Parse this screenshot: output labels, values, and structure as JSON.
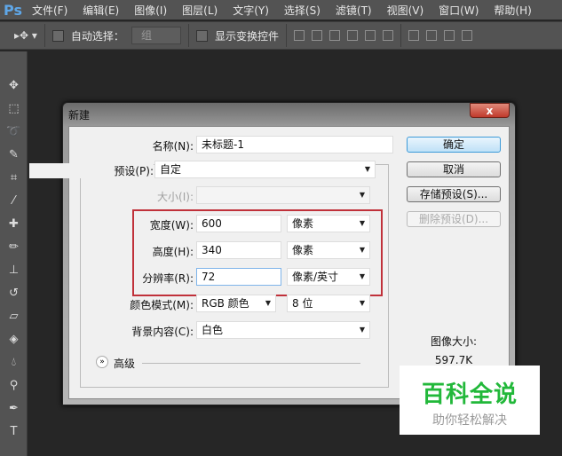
{
  "app": {
    "logo": "Ps"
  },
  "menu": [
    "文件(F)",
    "编辑(E)",
    "图像(I)",
    "图层(L)",
    "文字(Y)",
    "选择(S)",
    "滤镜(T)",
    "视图(V)",
    "窗口(W)",
    "帮助(H)"
  ],
  "options": {
    "auto_select": "自动选择：",
    "auto_select_value": "组",
    "show_transform": "显示变换控件"
  },
  "dialog": {
    "title": "新建",
    "name_label": "名称(N):",
    "name_value": "未标题-1",
    "preset_label": "预设(P):",
    "preset_value": "自定",
    "size_label": "大小(I):",
    "width_label": "宽度(W):",
    "width_value": "600",
    "width_unit": "像素",
    "height_label": "高度(H):",
    "height_value": "340",
    "height_unit": "像素",
    "res_label": "分辨率(R):",
    "res_value": "72",
    "res_unit": "像素/英寸",
    "mode_label": "颜色模式(M):",
    "mode_value": "RGB 颜色",
    "bit_value": "8 位",
    "bg_label": "背景内容(C):",
    "bg_value": "白色",
    "advanced": "高级",
    "ok": "确定",
    "cancel": "取消",
    "save_preset": "存储预设(S)...",
    "delete_preset": "删除预设(D)...",
    "image_size_label": "图像大小:",
    "image_size_value": "597.7K",
    "close": "x"
  },
  "watermark": {
    "title": "百科全说",
    "subtitle": "助你轻松解决"
  },
  "colors": {
    "highlight": "#c0313a",
    "ok_border": "#3c9ad8",
    "wm_green": "#22b83a"
  }
}
